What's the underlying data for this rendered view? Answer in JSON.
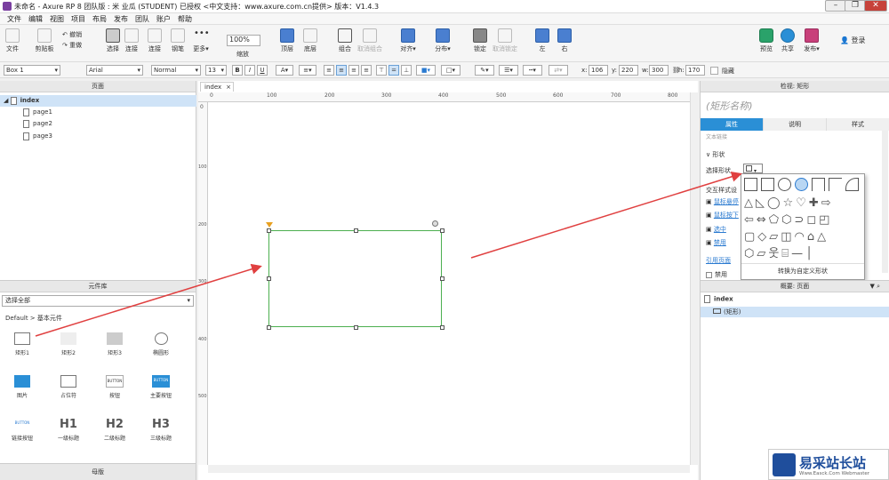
{
  "titlebar": {
    "title": "未命名 - Axure RP 8 团队版 : 米 业瓜 (STUDENT) 已授权     <中文支持：www.axure.com.cn提供> 版本：V1.4.3"
  },
  "menubar": {
    "items": [
      "文件",
      "编辑",
      "视图",
      "项目",
      "布局",
      "发布",
      "团队",
      "账户",
      "帮助"
    ]
  },
  "toolbar": {
    "file": "文件",
    "clipboard": "剪贴板",
    "undo": "撤销",
    "redo": "重做",
    "select": "选择",
    "connect": "连接",
    "pen": "钢笔",
    "more": "更多▾",
    "zoom_value": "100%",
    "zoom_label": "缩放",
    "top_layer": "顶层",
    "bottom_layer": "底层",
    "group": "组合",
    "ungroup": "取消组合",
    "align": "对齐▾",
    "distribute": "分布▾",
    "lock": "锁定",
    "unlock": "取消锁定",
    "left": "左",
    "right": "右",
    "preview": "预览",
    "share": "共享",
    "publish": "发布▾",
    "login": "登录"
  },
  "formatbar": {
    "shape_select": "Box 1",
    "font": "Arial",
    "style": "Normal",
    "size": "13",
    "bold": "B",
    "italic": "I",
    "underline": "U",
    "x_label": "x:",
    "x": "106",
    "y_label": "y:",
    "y": "220",
    "w_label": "w:",
    "w": "300",
    "h_label": "h:",
    "h": "170",
    "hide": "隐藏"
  },
  "pages": {
    "header": "页面",
    "items": [
      {
        "label": "index"
      },
      {
        "label": "page1"
      },
      {
        "label": "page2"
      },
      {
        "label": "page3"
      }
    ]
  },
  "library": {
    "header": "元件库",
    "select": "选择全部",
    "group": "Default > 基本元件",
    "widgets": [
      {
        "label": "矩形1"
      },
      {
        "label": "矩形2"
      },
      {
        "label": "矩形3"
      },
      {
        "label": "椭圆形"
      },
      {
        "label": "图片"
      },
      {
        "label": "占位符"
      },
      {
        "label": "按钮"
      },
      {
        "label": "主要按钮"
      },
      {
        "label": "链接按钮"
      },
      {
        "label": "一级标题"
      },
      {
        "label": "二级标题"
      },
      {
        "label": "三级标题"
      }
    ],
    "btn_text": "BUTTON",
    "h1": "H1",
    "h2": "H2",
    "h3": "H3"
  },
  "master": {
    "header": "母版"
  },
  "canvas": {
    "tab": "index",
    "ruler_h": [
      "0",
      "100",
      "200",
      "300",
      "400",
      "500",
      "600",
      "700",
      "800"
    ],
    "ruler_v": [
      "0",
      "100",
      "200",
      "300",
      "400",
      "500"
    ]
  },
  "inspector": {
    "header": "检视: 矩形",
    "name_placeholder": "(矩形名称)",
    "tabs": [
      "属性",
      "说明",
      "样式"
    ],
    "text_link": "文本链接",
    "shape_section": "形状",
    "select_shape": "选择形状",
    "interaction": "交互样式设",
    "links": [
      "鼠标悬停",
      "鼠标按下",
      "选中",
      "禁用"
    ],
    "ref_page": "引用页面",
    "disabled": "禁用"
  },
  "picker": {
    "footer": "转换为自定义形状"
  },
  "outline": {
    "header": "概要: 页面",
    "page": "index",
    "item": "(矩形)"
  },
  "watermark": {
    "title": "易采站长站",
    "url": "Www.Easck.Com  Webmaster"
  },
  "colors": {
    "accent": "#2a8fd6",
    "selection": "#4caf50",
    "arrow": "#e04040"
  }
}
